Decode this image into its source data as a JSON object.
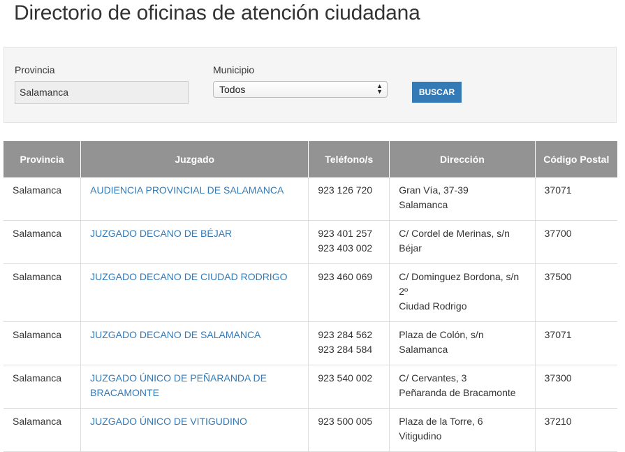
{
  "page": {
    "title": "Directorio de oficinas de atención ciudadana"
  },
  "filters": {
    "provincia_label": "Provincia",
    "provincia_value": "Salamanca",
    "municipio_label": "Municipio",
    "municipio_value": "Todos",
    "search_label": "BUSCAR"
  },
  "table": {
    "headers": [
      "Provincia",
      "Juzgado",
      "Teléfono/s",
      "Dirección",
      "Código Postal"
    ],
    "rows": [
      {
        "provincia": "Salamanca",
        "juzgado": "AUDIENCIA PROVINCIAL DE SALAMANCA",
        "telefono1": "923 126 720",
        "telefono2": "",
        "direccion1": "Gran Vía, 37-39",
        "direccion2": "Salamanca",
        "cp": "37071"
      },
      {
        "provincia": "Salamanca",
        "juzgado": "JUZGADO DECANO DE BÉJAR",
        "telefono1": "923 401 257",
        "telefono2": "923 403 002",
        "direccion1": "C/ Cordel de Merinas, s/n",
        "direccion2": "Béjar",
        "cp": "37700"
      },
      {
        "provincia": "Salamanca",
        "juzgado": "JUZGADO DECANO DE CIUDAD RODRIGO",
        "telefono1": "923 460 069",
        "telefono2": "",
        "direccion1": "C/ Dominguez Bordona, s/n 2º",
        "direccion2": "Ciudad Rodrigo",
        "cp": "37500"
      },
      {
        "provincia": "Salamanca",
        "juzgado": "JUZGADO DECANO DE SALAMANCA",
        "telefono1": "923 284 562",
        "telefono2": "923 284 584",
        "direccion1": "Plaza de Colón, s/n",
        "direccion2": "Salamanca",
        "cp": "37071"
      },
      {
        "provincia": "Salamanca",
        "juzgado": "JUZGADO ÚNICO DE PEÑARANDA DE BRACAMONTE",
        "telefono1": "923 540 002",
        "telefono2": "",
        "direccion1": "C/ Cervantes, 3",
        "direccion2": "Peñaranda de Bracamonte",
        "cp": "37300"
      },
      {
        "provincia": "Salamanca",
        "juzgado": "JUZGADO ÚNICO DE VITIGUDINO",
        "telefono1": "923 500 005",
        "telefono2": "",
        "direccion1": "Plaza de la Torre, 6",
        "direccion2": "Vitigudino",
        "cp": "37210"
      }
    ]
  }
}
